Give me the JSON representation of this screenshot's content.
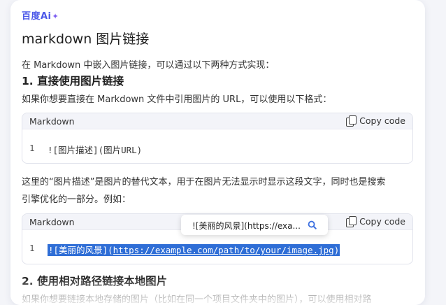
{
  "brand": {
    "logo_text": "百度Ai",
    "logo_star": "✦"
  },
  "title": "markdown 图片链接",
  "intro": "在 Markdown 中嵌入图片链接，可以通过以下两种方式实现：",
  "section1": {
    "heading": "1. 直接使用图片链接",
    "desc": "如果你想要直接在 Markdown 文件中引用图片的 URL，可以使用以下格式："
  },
  "code1": {
    "lang": "Markdown",
    "copy_label": "Copy code",
    "line_no": "1",
    "code": "![图片描述](图片URL)"
  },
  "para2": {
    "line1": "这里的“图片描述”是图片的替代文本，用于在图片无法显示时显示这段文字，同时也是搜索",
    "line2": "引擎优化的一部分。例如："
  },
  "code2": {
    "lang": "Markdown",
    "copy_label": "Copy code",
    "line_no": "1",
    "code_prefix": "![美丽的风景](",
    "code_url": "https://example.com/path/to/your/image.jpg",
    "code_suffix": ")"
  },
  "tooltip": {
    "text": "![美丽的风景](https://exa...",
    "icon": "search-icon"
  },
  "section2": {
    "heading": "2. 使用相对路径链接本地图片",
    "desc": "如果你想要链接本地存储的图片（比如在同一个项目文件夹中的图片），可以使用相对路"
  }
}
